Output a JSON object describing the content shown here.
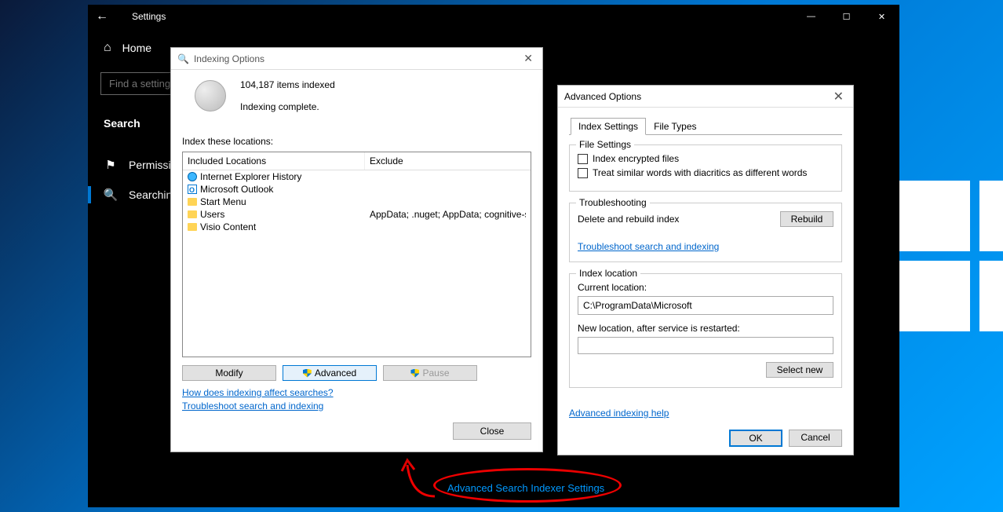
{
  "desktop": {},
  "settings": {
    "back": "←",
    "title": "Settings",
    "win_min": "—",
    "win_max": "☐",
    "win_close": "✕",
    "home": "Home",
    "search_placeholder": "Find a setting",
    "section": "Search",
    "nav": {
      "permissions": "Permissions & History",
      "searching": "Searching Windows"
    },
    "adv_link": "Advanced Search Indexer Settings"
  },
  "indexing": {
    "title": "Indexing Options",
    "close_x": "✕",
    "items_indexed": "104,187 items indexed",
    "status": "Indexing complete.",
    "locations_label": "Index these locations:",
    "col_included": "Included Locations",
    "col_exclude": "Exclude",
    "rows": [
      {
        "name": "Internet Explorer History",
        "icon": "ie",
        "exclude": ""
      },
      {
        "name": "Microsoft Outlook",
        "icon": "outlook",
        "exclude": ""
      },
      {
        "name": "Start Menu",
        "icon": "folder",
        "exclude": ""
      },
      {
        "name": "Users",
        "icon": "folder",
        "exclude": "AppData; .nuget; AppData; cognitive-services..."
      },
      {
        "name": "Visio Content",
        "icon": "folder",
        "exclude": ""
      }
    ],
    "btn_modify": "Modify",
    "btn_advanced": "Advanced",
    "btn_pause": "Pause",
    "link_affect": "How does indexing affect searches?",
    "link_trouble": "Troubleshoot search and indexing",
    "btn_close": "Close"
  },
  "advanced": {
    "title": "Advanced Options",
    "close_x": "✕",
    "tab_index": "Index Settings",
    "tab_filetypes": "File Types",
    "grp_file": "File Settings",
    "chk_encrypted": "Index encrypted files",
    "chk_diacritics": "Treat similar words with diacritics as different words",
    "grp_trouble": "Troubleshooting",
    "trouble_label": "Delete and rebuild index",
    "btn_rebuild": "Rebuild",
    "link_trouble": "Troubleshoot search and indexing",
    "grp_loc": "Index location",
    "loc_current_label": "Current location:",
    "loc_current": "C:\\ProgramData\\Microsoft",
    "loc_new_label": "New location, after service is restarted:",
    "btn_selectnew": "Select new",
    "link_help": "Advanced indexing help",
    "btn_ok": "OK",
    "btn_cancel": "Cancel"
  }
}
